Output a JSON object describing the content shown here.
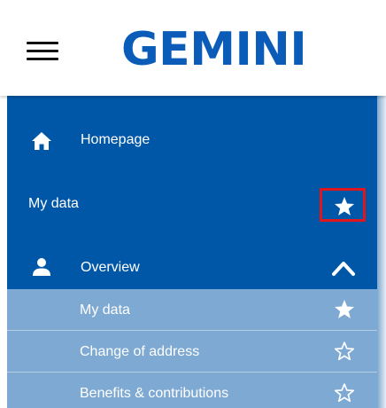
{
  "header": {
    "logo_text": "GEMINI",
    "menu_icon": "hamburger-menu-icon"
  },
  "colors": {
    "brand": "#0a5cb8",
    "sidebar_bg": "#0057a8",
    "sub_item_bg": "#7ea9d2",
    "highlight": "#e1161c"
  },
  "sidebar": {
    "homepage": {
      "label": "Homepage",
      "icon": "home-icon"
    },
    "section": {
      "label": "My data",
      "favorite_icon": "star-filled-icon"
    },
    "overview": {
      "label": "Overview",
      "icon": "user-icon",
      "expand_icon": "chevron-up-icon"
    },
    "sub_items": [
      {
        "label": "My data",
        "icon": "star-filled-icon"
      },
      {
        "label": "Change of address",
        "icon": "star-outline-icon"
      },
      {
        "label": "Benefits & contributions",
        "icon": "star-outline-icon"
      }
    ]
  }
}
